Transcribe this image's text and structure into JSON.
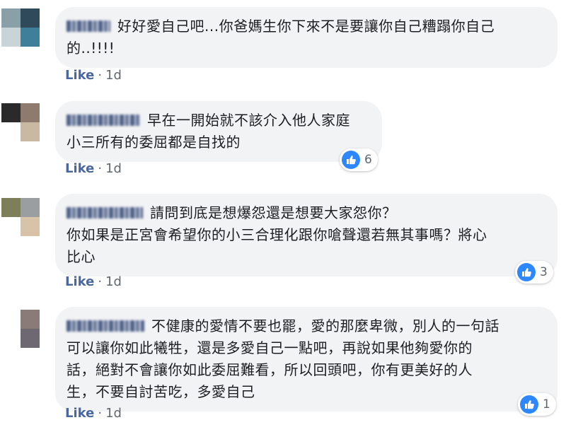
{
  "comments": [
    {
      "text_lines": [
        "好好愛自己吧...你爸媽生你下來不是要讓你自己糟蹋你自己",
        "的..!!!!"
      ],
      "like_label": "Like",
      "separator": "·",
      "time": "1d",
      "reaction_count": "",
      "avatar_colors": [
        "#8aa0a9",
        "#2f4a5b",
        "#c9d4d8",
        "#3f7f9a"
      ]
    },
    {
      "text_lines": [
        "早在一開始就不該介入他人家庭",
        "小三所有的委屈都是自找的"
      ],
      "like_label": "Like",
      "separator": "·",
      "time": "1d",
      "reaction_count": "6",
      "avatar_colors": [
        "#2a2a2a",
        "#8f7a6e",
        "#ffffff",
        "#c9b9a3"
      ]
    },
    {
      "text_lines": [
        "請問到底是想爆怨還是想要大家怨你？",
        "你如果是正宮會希望你的小三合理化跟你嗆聲還若無其事嗎？將心",
        "比心"
      ],
      "like_label": "Like",
      "separator": "·",
      "time": "1d",
      "reaction_count": "3",
      "avatar_colors": [
        "#7d7f5a",
        "#9a9ea1",
        "#ffffff",
        "#d8c2a8"
      ]
    },
    {
      "text_lines": [
        "不健康的愛情不要也罷，愛的那麼卑微，別人的一句話",
        "可以讓你如此犧牲，還是多愛自己一點吧，再說如果他夠愛你的",
        "話，絕對不會讓你如此委屈難看，所以回頭吧，你有更美好的人",
        "生，不要自討苦吃，多愛自己"
      ],
      "like_label": "Like",
      "separator": "·",
      "time": "1d",
      "reaction_count": "1",
      "avatar_colors": [
        "#ffffff",
        "#8a7a78",
        "#ffffff",
        "#6e6872"
      ]
    }
  ]
}
